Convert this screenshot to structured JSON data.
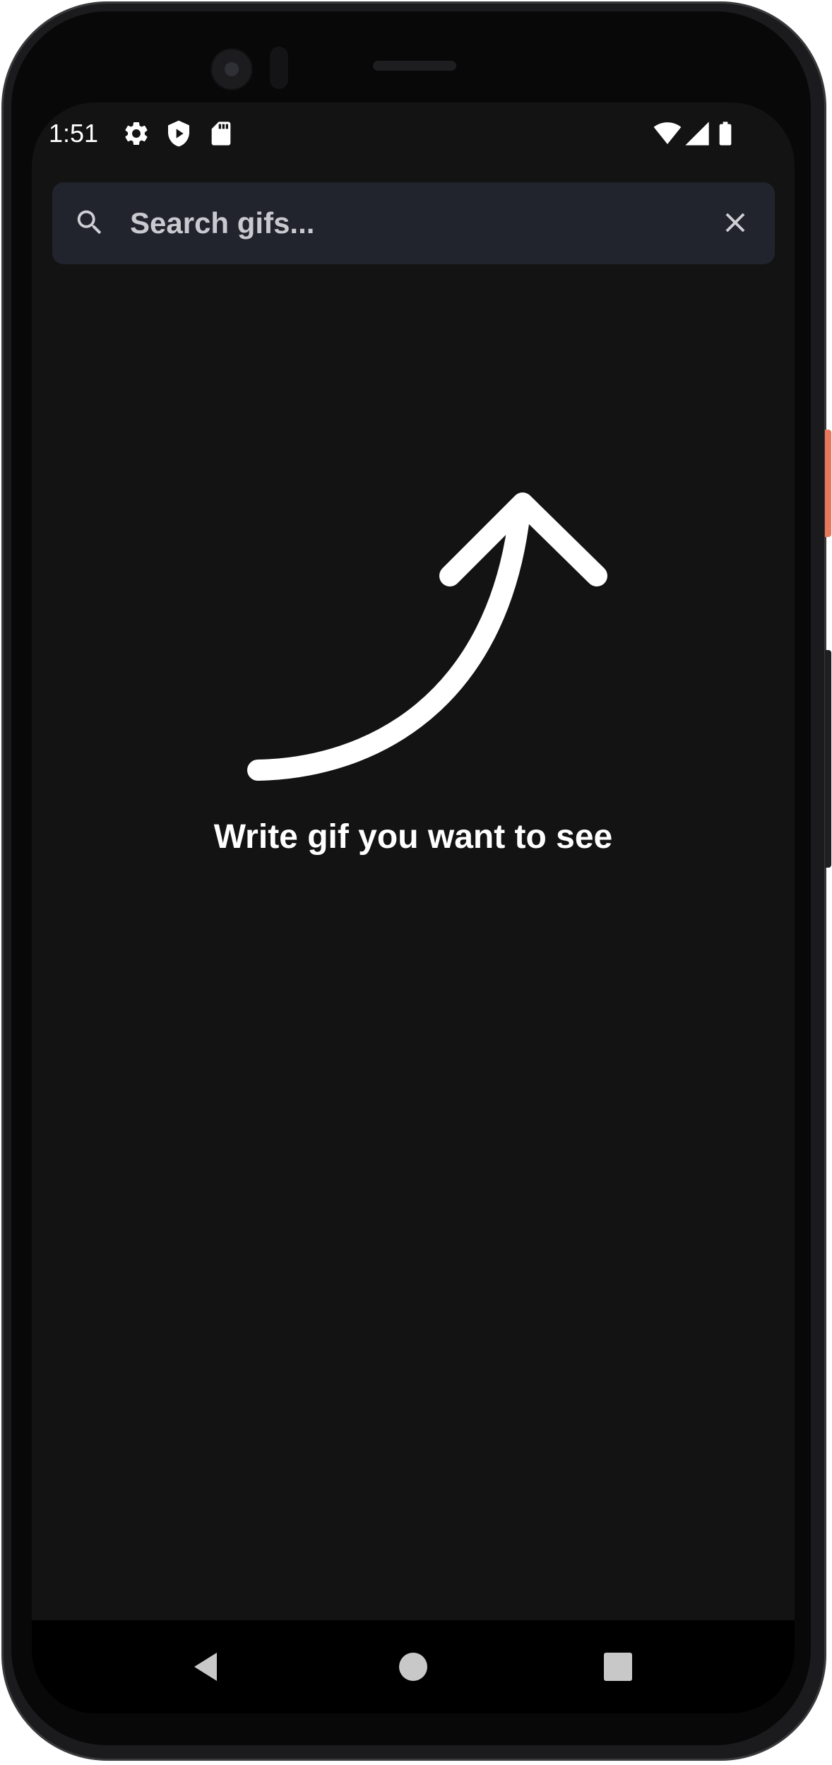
{
  "status_bar": {
    "time": "1:51",
    "left_icons": [
      "gear-icon",
      "shield-play-icon",
      "sd-card-icon"
    ],
    "right_icons": [
      "wifi-icon",
      "cell-signal-icon",
      "battery-icon"
    ]
  },
  "search": {
    "placeholder": "Search gifs...",
    "value": "",
    "search_icon": "search-icon",
    "clear_icon": "close-icon"
  },
  "empty_state": {
    "icon": "curved-arrow-up-icon",
    "message": "Write gif you want to see"
  },
  "navigation": {
    "buttons": [
      "back-icon",
      "home-icon",
      "recents-icon"
    ]
  },
  "colors": {
    "background": "#131313",
    "search_bar": "#21242d",
    "text_primary": "#ffffff",
    "placeholder": "#c9cacf",
    "nav_bar": "#000000",
    "accent_button": "#e8775b"
  }
}
